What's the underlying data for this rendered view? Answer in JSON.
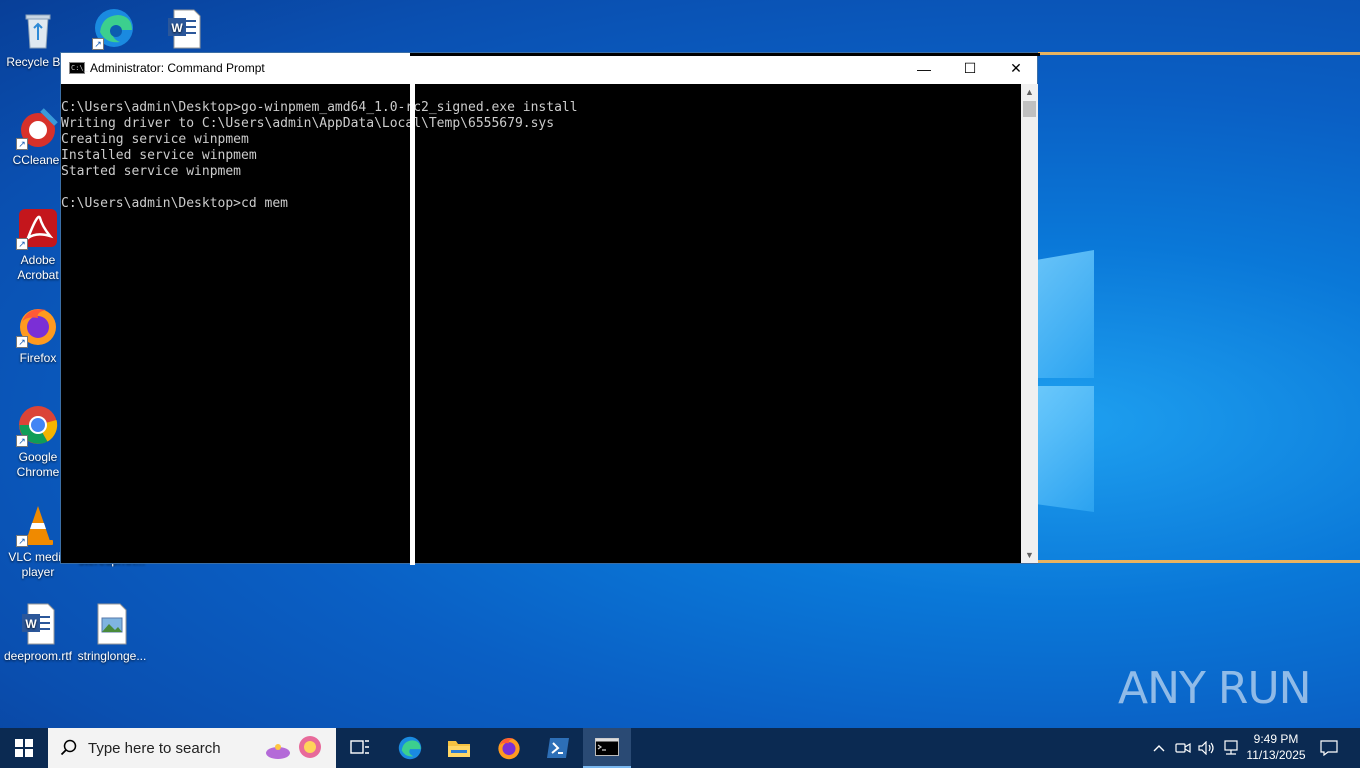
{
  "desktop": {
    "icons": [
      {
        "label": "Recycle Bin",
        "icon": "recycle-bin-icon"
      },
      {
        "label": "",
        "icon": "edge-icon"
      },
      {
        "label": "",
        "icon": "word-doc-icon"
      },
      {
        "label": "CCleaner",
        "icon": "ccleaner-icon"
      },
      {
        "label": "Adobe Acrobat",
        "icon": "acrobat-icon"
      },
      {
        "label": "Firefox",
        "icon": "firefox-icon"
      },
      {
        "label": "Google Chrome",
        "icon": "chrome-icon"
      },
      {
        "label": "VLC media player",
        "icon": "vlc-icon"
      },
      {
        "label": "deeproom.rtf",
        "icon": "word-doc-icon"
      },
      {
        "label": "stringlonge...",
        "icon": "image-file-icon"
      }
    ],
    "partial_label": "steresprnn..."
  },
  "cmd_window": {
    "title": "Administrator: Command Prompt",
    "icon_text": "C:\\_",
    "minimize_glyph": "—",
    "maximize_glyph": "☐",
    "close_glyph": "✕",
    "console_text": "C:\\Users\\admin\\Desktop>go-winpmem_amd64_1.0-rc2_signed.exe install\nWriting driver to C:\\Users\\admin\\AppData\\Local\\Temp\\6555679.sys\nCreating service winpmem\nInstalled service winpmem\nStarted service winpmem\n\nC:\\Users\\admin\\Desktop>cd mem"
  },
  "taskbar": {
    "search_placeholder": "Type here to search",
    "apps": [
      "task-view",
      "edge",
      "file-explorer",
      "firefox",
      "powershell",
      "command-prompt"
    ],
    "active_app": "command-prompt",
    "clock_time": "9:49 PM",
    "clock_date": "11/13/2025"
  },
  "watermark": {
    "text": "ANY RUN"
  },
  "colors": {
    "taskbar": "#0b2a52",
    "console_bg": "#000000",
    "console_fg": "#cccccc",
    "accent_beam": "#e8b360"
  }
}
